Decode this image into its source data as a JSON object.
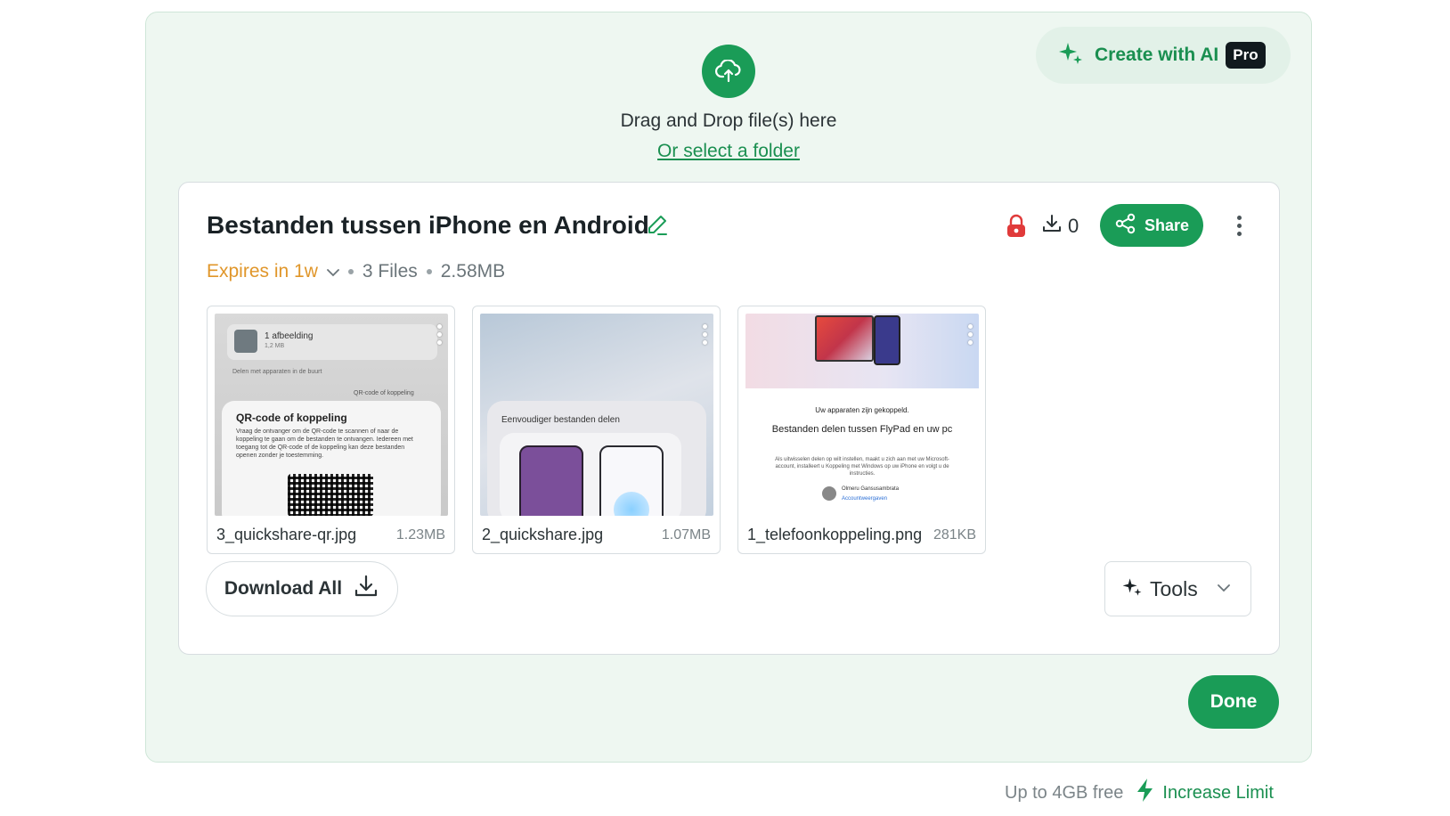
{
  "colors": {
    "accent": "#1a9c57",
    "expires": "#e0962a",
    "lock": "#e03a3a"
  },
  "upload": {
    "icon": "cloud-upload-icon",
    "drag_text": "Drag and Drop file(s) here",
    "select_folder": "Or select a folder"
  },
  "ai_button": {
    "label": "Create with AI",
    "badge": "Pro",
    "icon": "sparkle-icon"
  },
  "transfer": {
    "title": "Bestanden tussen iPhone en Android",
    "expires": "Expires in 1w",
    "file_count": "3 Files",
    "total_size": "2.58MB",
    "download_count": "0",
    "share_label": "Share"
  },
  "files": [
    {
      "name": "3_quickshare-qr.jpg",
      "size": "1.23MB",
      "thumb": {
        "line1": "1 afbeelding",
        "line2": "1,2 MB",
        "line3": "Delen met apparaten in de buurt",
        "line4": "QR-code of koppeling",
        "heading": "QR-code of koppeling",
        "body": "Vraag de ontvanger om de QR-code te scannen of naar de koppeling te gaan om de bestanden te ontvangen. Iedereen met toegang tot de QR-code of de koppeling kan deze bestanden openen zonder je toestemming."
      }
    },
    {
      "name": "2_quickshare.jpg",
      "size": "1.07MB",
      "thumb": {
        "heading": "Eenvoudiger bestanden delen"
      }
    },
    {
      "name": "1_telefoonkoppeling.png",
      "size": "281KB",
      "thumb": {
        "small": "Uw apparaten zijn gekoppeld.",
        "heading": "Bestanden delen tussen FlyPad en uw pc",
        "body": "Als uitwisselen delen op wilt instellen, maakt u zich aan met uw Microsoft-account, installeert u Koppeling met Windows op uw iPhone en volgt u de instructies.",
        "person": "Olmeru Gansusambrata",
        "link": "Accountweergaven"
      }
    }
  ],
  "actions": {
    "download_all": "Download All",
    "tools": "Tools",
    "done": "Done"
  },
  "footer": {
    "free": "Up to 4GB free",
    "increase": "Increase Limit"
  }
}
